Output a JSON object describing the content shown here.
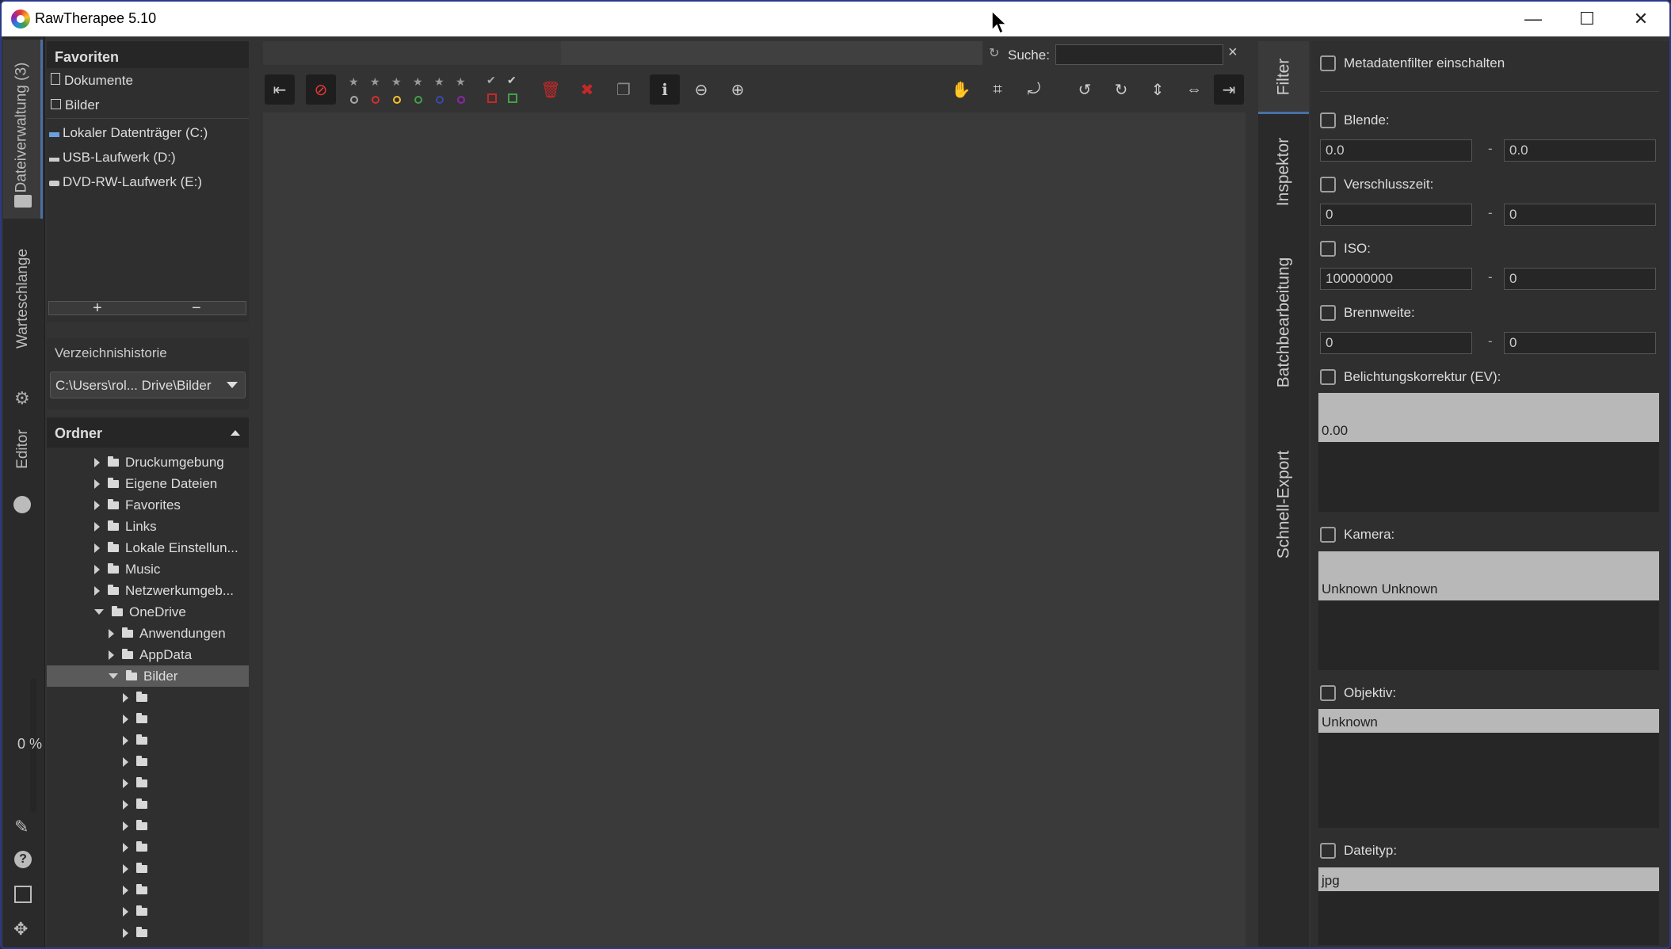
{
  "window": {
    "title": "RawTherapee 5.10",
    "minimize": "—",
    "maximize": "☐",
    "close": "✕"
  },
  "left_tabs": {
    "file_browser": "Dateiverwaltung (3)",
    "queue": "Warteschlange",
    "editor": "Editor",
    "progress": "0 %"
  },
  "favorites": {
    "header": "Favoriten",
    "items": [
      "Dokumente",
      "Bilder"
    ],
    "drives": [
      "Lokaler Datenträger (C:)",
      "USB-Laufwerk (D:)",
      "DVD-RW-Laufwerk (E:)"
    ],
    "add": "+",
    "remove": "−"
  },
  "history": {
    "header": "Verzeichnishistorie",
    "selected": "C:\\Users\\rol... Drive\\Bilder"
  },
  "folders": {
    "header": "Ordner",
    "items": [
      "Druckumgebung",
      "Eigene Dateien",
      "Favorites",
      "Links",
      "Lokale Einstellun...",
      "Music",
      "Netzwerkumgeb...",
      "OneDrive",
      "Anwendungen",
      "AppData",
      "Bilder"
    ]
  },
  "search": {
    "label": "Suche:",
    "value": "",
    "clear": "×"
  },
  "right_tabs": [
    "Filter",
    "Inspektor",
    "Batchbearbeitung",
    "Schnell-Export"
  ],
  "filter": {
    "enable_metadata": "Metadatenfilter einschalten",
    "aperture": {
      "label": "Blende:",
      "from": "0.0",
      "to": "0.0"
    },
    "shutter": {
      "label": "Verschlusszeit:",
      "from": "0",
      "to": "0"
    },
    "iso": {
      "label": "ISO:",
      "from": "100000000",
      "to": "0"
    },
    "focal": {
      "label": "Brennweite:",
      "from": "0",
      "to": "0"
    },
    "exposure": {
      "label": "Belichtungskorrektur (EV):",
      "value": "0.00"
    },
    "camera": {
      "label": "Kamera:",
      "value": "Unknown Unknown"
    },
    "lens": {
      "label": "Objektiv:",
      "value": "Unknown"
    },
    "filetype": {
      "label": "Dateityp:",
      "value": "jpg"
    },
    "dash": "-"
  },
  "colors": {
    "accent": "#4a6fa5",
    "background": "#333333",
    "panel": "#2f2f2f"
  }
}
